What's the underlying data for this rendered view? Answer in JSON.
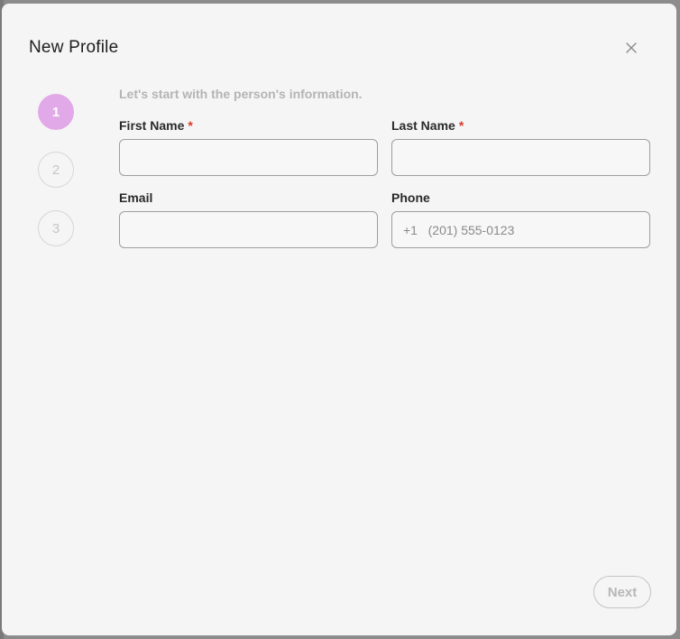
{
  "dialog": {
    "title": "New Profile",
    "intro": "Let's start with the person's information."
  },
  "stepper": {
    "steps": [
      {
        "label": "1",
        "state": "active"
      },
      {
        "label": "2",
        "state": "inactive"
      },
      {
        "label": "3",
        "state": "inactive"
      }
    ]
  },
  "form": {
    "first_name": {
      "label": "First Name",
      "required_mark": "*",
      "value": "",
      "placeholder": ""
    },
    "last_name": {
      "label": "Last Name",
      "required_mark": "*",
      "value": "",
      "placeholder": ""
    },
    "email": {
      "label": "Email",
      "value": "",
      "placeholder": ""
    },
    "phone": {
      "label": "Phone",
      "value": "",
      "placeholder": "+1   (201) 555-0123"
    }
  },
  "footer": {
    "next_label": "Next"
  },
  "colors": {
    "accent_step": "#e2a9e8",
    "required": "#d83a2b"
  },
  "icons": {
    "close": "close-icon"
  }
}
